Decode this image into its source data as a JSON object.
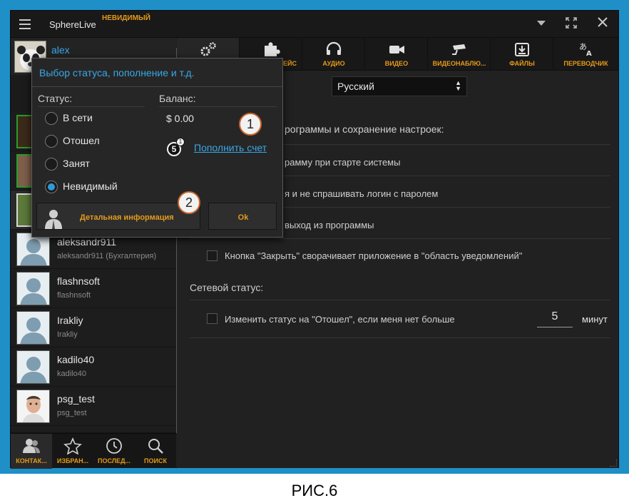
{
  "window": {
    "title": "SphereLive",
    "status_tag": "НЕВИДИМЫЙ"
  },
  "user": {
    "name": "alex"
  },
  "popup": {
    "title": "Выбор статуса, пополнение и т.д.",
    "status_head": "Статус:",
    "balance_head": "Баланс:",
    "statuses": [
      "В сети",
      "Отошел",
      "Занят",
      "Невидимый"
    ],
    "selected_status": "Невидимый",
    "balance": "$ 0.00",
    "topup_link": "Пополнить счет",
    "details_button": "Детальная информация",
    "ok_button": "Ok"
  },
  "contacts": [
    {
      "name": "aleksandr911",
      "sub": "aleksandr911 (Бухгалтерия)"
    },
    {
      "name": "flashnsoft",
      "sub": "flashnsoft"
    },
    {
      "name": "Irakliy",
      "sub": "Irakliy"
    },
    {
      "name": "kadilo40",
      "sub": "kadilo40"
    },
    {
      "name": "psg_test",
      "sub": "psg_test"
    }
  ],
  "bottom_nav": [
    {
      "label": "КОНТАК...",
      "icon": "contacts-icon"
    },
    {
      "label": "ИЗБРАН...",
      "icon": "star-icon"
    },
    {
      "label": "ПОСЛЕД...",
      "icon": "clock-icon"
    },
    {
      "label": "ПОИСК",
      "icon": "search-icon"
    }
  ],
  "toolbar": [
    {
      "label": "",
      "icon": "gears-icon"
    },
    {
      "label": "ЕЙС",
      "icon": "puzzle-icon"
    },
    {
      "label": "АУДИО",
      "icon": "headset-icon"
    },
    {
      "label": "ВИДЕО",
      "icon": "camera-icon"
    },
    {
      "label": "ВИДЕОНАБЛЮ...",
      "icon": "cctv-icon"
    },
    {
      "label": "ФАЙЛЫ",
      "icon": "download-icon"
    },
    {
      "label": "ПЕРЕВОДЧИК",
      "icon": "translate-icon"
    }
  ],
  "settings": {
    "language": "Русский",
    "section1_tail": "рограммы и сохранение настроек:",
    "opt1_tail": "рамму при старте системы",
    "opt2_tail": "я и не спрашивать логин с паролем",
    "opt3_tail": "выход из программы",
    "opt4": "Кнопка \"Закрыть\" сворачивает приложение в \"область уведомлений\"",
    "network_head": "Сетевой статус:",
    "opt5": "Изменить статус на \"Отошел\", если меня нет больше",
    "minutes_value": "5",
    "minutes_label": "минут"
  },
  "callouts": {
    "one": "1",
    "two": "2",
    "five": "5",
    "five_sub": "1"
  },
  "caption": "РИС.6",
  "colors": {
    "accent": "#e59a1b",
    "link": "#39a8e8",
    "frame": "#1f8fc8",
    "radio_on": "#2f9ad8"
  }
}
